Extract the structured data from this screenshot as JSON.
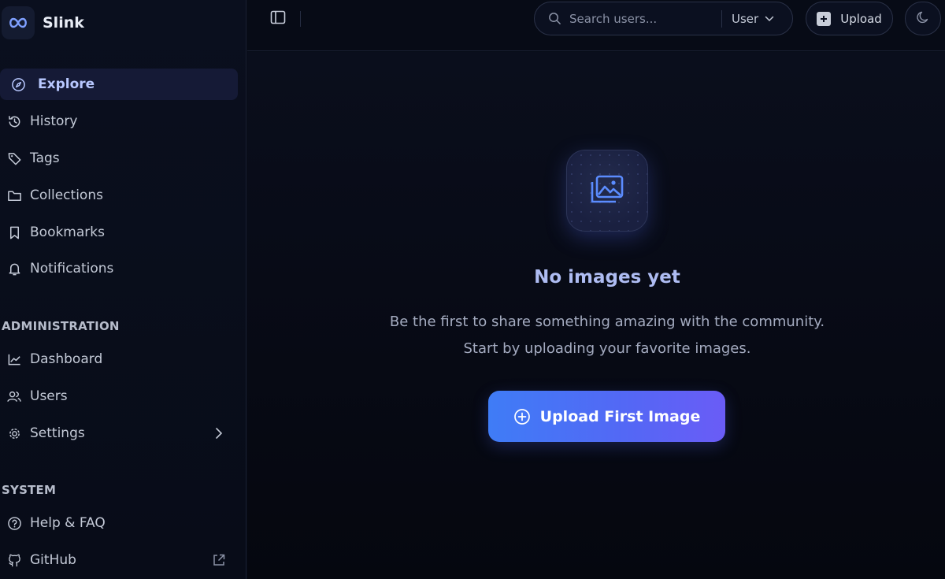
{
  "brand": {
    "name": "Slink"
  },
  "nav": {
    "items": [
      {
        "label": "Explore",
        "icon": "compass-icon",
        "active": true
      },
      {
        "label": "History",
        "icon": "history-icon"
      },
      {
        "label": "Tags",
        "icon": "tag-icon"
      },
      {
        "label": "Collections",
        "icon": "folder-icon"
      },
      {
        "label": "Bookmarks",
        "icon": "bookmark-icon"
      },
      {
        "label": "Notifications",
        "icon": "bell-icon"
      }
    ],
    "admin_title": "ADMINISTRATION",
    "admin_items": [
      {
        "label": "Dashboard",
        "icon": "chart-line-icon"
      },
      {
        "label": "Users",
        "icon": "users-icon"
      },
      {
        "label": "Settings",
        "icon": "gear-icon"
      }
    ],
    "system_title": "SYSTEM",
    "system_items": [
      {
        "label": "Help & FAQ",
        "icon": "help-circle-icon"
      },
      {
        "label": "GitHub",
        "icon": "github-icon"
      }
    ]
  },
  "topbar": {
    "search_placeholder": "Search users...",
    "search_scope": "User",
    "upload_label": "Upload"
  },
  "main": {
    "title": "No images yet",
    "line1": "Be the first to share something amazing with the community.",
    "line2": "Start by uploading your favorite images.",
    "cta_label": "Upload First Image"
  },
  "colors": {
    "background": "#070b16",
    "accent": "#4f6ef5",
    "active_nav_bg": "#151a36"
  }
}
